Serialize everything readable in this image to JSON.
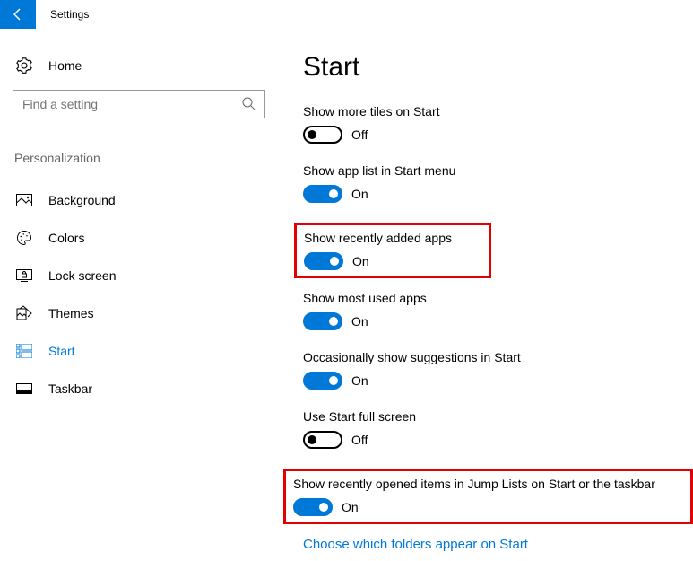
{
  "titlebar": {
    "text": "Settings"
  },
  "sidebar": {
    "home": "Home",
    "search_placeholder": "Find a setting",
    "section": "Personalization",
    "items": [
      {
        "label": "Background"
      },
      {
        "label": "Colors"
      },
      {
        "label": "Lock screen"
      },
      {
        "label": "Themes"
      },
      {
        "label": "Start"
      },
      {
        "label": "Taskbar"
      }
    ]
  },
  "main": {
    "title": "Start",
    "settings": [
      {
        "label": "Show more tiles on Start",
        "state": "Off",
        "on": false
      },
      {
        "label": "Show app list in Start menu",
        "state": "On",
        "on": true
      },
      {
        "label": "Show recently added apps",
        "state": "On",
        "on": true
      },
      {
        "label": "Show most used apps",
        "state": "On",
        "on": true
      },
      {
        "label": "Occasionally show suggestions in Start",
        "state": "On",
        "on": true
      },
      {
        "label": "Use Start full screen",
        "state": "Off",
        "on": false
      },
      {
        "label": "Show recently opened items in Jump Lists on Start or the taskbar",
        "state": "On",
        "on": true
      }
    ],
    "link": "Choose which folders appear on Start"
  }
}
